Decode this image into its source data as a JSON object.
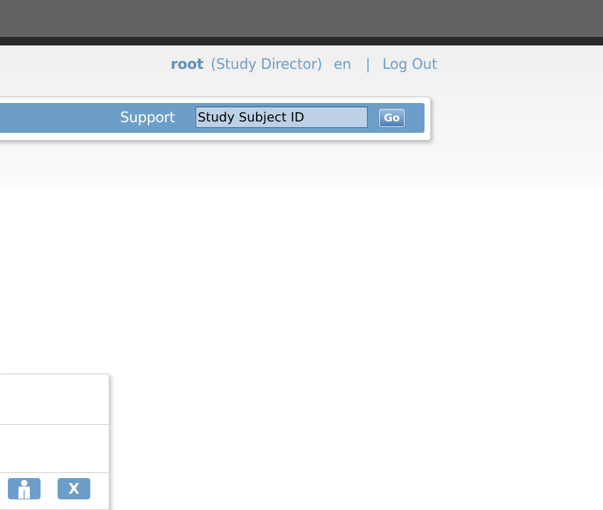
{
  "header": {
    "username": "root",
    "role": "(Study Director)",
    "language": "en",
    "separator": "|",
    "logout_label": "Log Out"
  },
  "navbar": {
    "support_label": "Support",
    "search": {
      "value": "Study Subject ID",
      "placeholder": "Study Subject ID"
    },
    "go_label": "Go"
  },
  "panel": {
    "actions": [
      {
        "icon": "person-icon"
      },
      {
        "icon": "remove-icon",
        "label": "X"
      }
    ]
  },
  "colors": {
    "accent": "#6d9ec9",
    "link": "#6e9dc8",
    "browser_chrome": "#636363"
  }
}
